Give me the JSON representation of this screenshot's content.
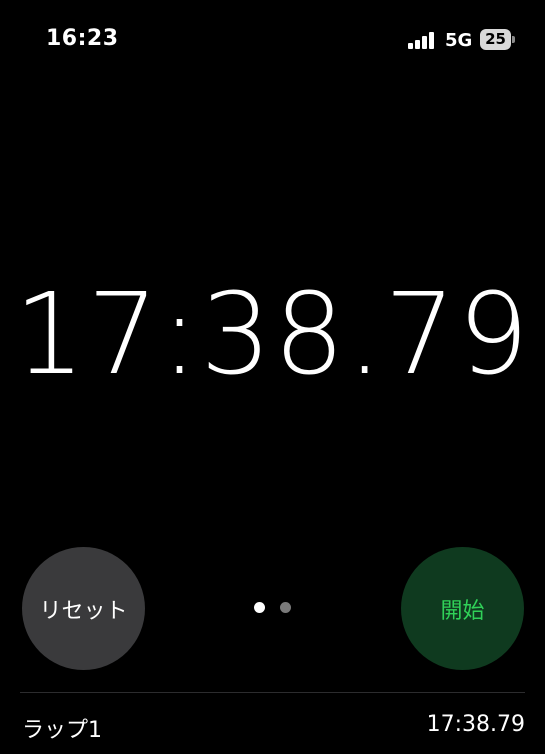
{
  "status_bar": {
    "time": "16:23",
    "network": "5G",
    "battery": "25",
    "icons": [
      "signal-icon",
      "battery-icon"
    ]
  },
  "stopwatch": {
    "display": "17:38.79"
  },
  "controls": {
    "reset_label": "リセット",
    "start_label": "開始",
    "page_indicator": {
      "pages": 2,
      "current": 1
    }
  },
  "laps": [
    {
      "label": "ラップ1",
      "time": "17:38.79"
    }
  ],
  "colors": {
    "background": "#000000",
    "reset_button": "#3a3a3c",
    "start_button_bg": "#0f3a1f",
    "start_button_text": "#30d158"
  }
}
